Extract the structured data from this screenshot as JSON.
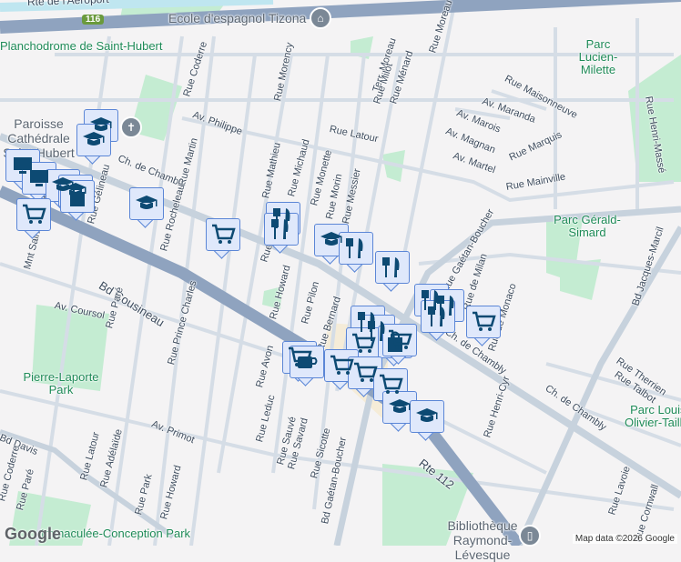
{
  "map": {
    "route_badge": "116",
    "highway_labels": {
      "top": "Rte de l'Aéroport",
      "rte112": "Rte 112",
      "cousineau": "Bd Cousineau"
    },
    "pois": {
      "school": "Ecole d'espagnol Tizona",
      "church": "Paroisse Cathédrale Saint-Hubert",
      "library": "Bibliothèque Raymond-Lévesque"
    },
    "parks": [
      "Planchodrome de Saint-Hubert",
      "Parc Lucien-Milette",
      "Parc Gérald-Simard",
      "Pierre-Laporte Park",
      "Immaculée-Conception Park",
      "Parc Louis-Olivier-Taillon"
    ],
    "streets": [
      "Ch. de Chambly",
      "Ch. de Chambly",
      "Ch. de Chambly",
      "Rue Coderre",
      "Av. Philippe",
      "Rue Morency",
      "Rue Latour",
      "Rue Mathieu",
      "Rue Michaud",
      "Rue Monette",
      "Rue Morin",
      "Rue Messier",
      "Rue Martin",
      "Rue Gélineau",
      "Rue Rocheleau",
      "Mnt Saint-Hubert",
      "Av. Coursol",
      "Rue Paré",
      "Rue Prince Charles",
      "Av. Primot",
      "Rue Howard",
      "Rue Pilon",
      "Rue Avon",
      "Rue Leduc",
      "Rue Sauvé",
      "Rue Savard",
      "Rue Sicotte",
      "Bd Gaétan-Boucher",
      "Bd Davis",
      "Rue Latour",
      "Rue Adélaïde",
      "Rue Park",
      "Rue Howard",
      "Rue Coderre",
      "Rue Paré",
      "Terr. Moreau",
      "Rue Milot",
      "Rue Ménard",
      "Rue Moreau",
      "Rue Maisonneuve",
      "Av. Maranda",
      "Av. Marois",
      "Av. Magnan",
      "Av. Martel",
      "Rue Marquis",
      "Rue Mainville",
      "Rue Henri-Massé",
      "Bd Jacques-Marcil",
      "Rue Therrien",
      "Rue Talbot",
      "Rue Henri-Cyr",
      "Rue Lavoie",
      "Rue Cornwall",
      "Rue de Milan",
      "Rue de Monaco",
      "Rue Park",
      "Rue Bernard",
      "Rue Gaétan-Boucher"
    ],
    "markers": [
      "school",
      "school",
      "monitor",
      "monitor",
      "school",
      "school",
      "cart",
      "bag",
      "school",
      "cart",
      "restaurant",
      "restaurant",
      "school",
      "restaurant",
      "restaurant",
      "restaurant",
      "restaurant",
      "restaurant",
      "cart",
      "restaurant",
      "restaurant",
      "cart",
      "bag",
      "cart",
      "cart",
      "coffee",
      "cart",
      "cart",
      "cart",
      "school",
      "school"
    ],
    "credit": "Map data ©2026 Google",
    "logo": "Google"
  }
}
